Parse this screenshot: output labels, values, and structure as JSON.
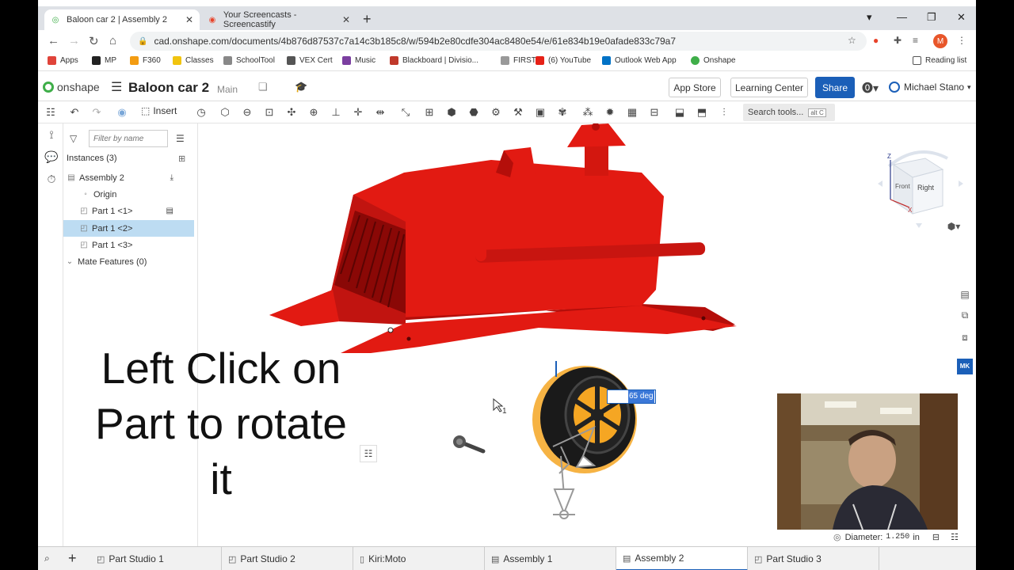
{
  "browser": {
    "tabs": [
      {
        "title": "Baloon car 2 | Assembly 2",
        "active": true
      },
      {
        "title": "Your Screencasts - Screencastify",
        "active": false
      }
    ],
    "url": "cad.onshape.com/documents/4b876d87537c7a14c3b185c8/w/594b2e80cdfe304ac8480e54/e/61e834b19e0afade833c79a7",
    "profile_initial": "M",
    "bookmarks": [
      "Apps",
      "MP",
      "F360",
      "Classes",
      "SchoolTool",
      "VEX Cert",
      "Music",
      "Blackboard | Divisio...",
      "FIRST",
      "(6) YouTube",
      "Outlook Web App",
      "Onshape"
    ],
    "reading_list": "Reading list"
  },
  "header": {
    "logo": "onshape",
    "doc_title": "Baloon car 2",
    "branch": "Main",
    "app_store": "App Store",
    "learning_center": "Learning Center",
    "share": "Share",
    "help": "?",
    "user": "Michael Stano"
  },
  "toolbar": {
    "insert": "Insert",
    "search_tools": "Search tools...",
    "search_kbd": "alt C"
  },
  "panel": {
    "filter_placeholder": "Filter by name",
    "instances_title": "Instances (3)",
    "tree": [
      {
        "label": "Assembly 2",
        "icon": "assembly-icon"
      },
      {
        "label": "Origin",
        "icon": "origin-icon"
      },
      {
        "label": "Part 1 <1>",
        "icon": "part-icon"
      },
      {
        "label": "Part 1 <2>",
        "icon": "part-icon",
        "selected": true
      },
      {
        "label": "Part 1 <3>",
        "icon": "part-icon"
      },
      {
        "label": "Mate Features (0)",
        "icon": "chevron-down-icon"
      }
    ]
  },
  "canvas": {
    "overlay_text": [
      "Left Click on",
      "Part to rotate",
      "it"
    ],
    "rotation_value": "65 deg",
    "cursor_subscript": "1",
    "viewcube_labels": {
      "front": "Front",
      "right": "Right",
      "z": "Z",
      "x": "X"
    },
    "measure_label": "Diameter:",
    "measure_value": "1.250",
    "measure_unit": "in",
    "side_badge": "MK"
  },
  "bottom_tabs": [
    {
      "label": "Part Studio 1",
      "active": false
    },
    {
      "label": "Part Studio 2",
      "active": false
    },
    {
      "label": "Kiri:Moto",
      "active": false
    },
    {
      "label": "Assembly 1",
      "active": false
    },
    {
      "label": "Assembly 2",
      "active": true
    },
    {
      "label": "Part Studio 3",
      "active": false
    }
  ],
  "colors": {
    "accent": "#1b5fb8",
    "selection": "#bddcf2",
    "part_red": "#e21a12",
    "onshape_green": "#3fae49"
  }
}
